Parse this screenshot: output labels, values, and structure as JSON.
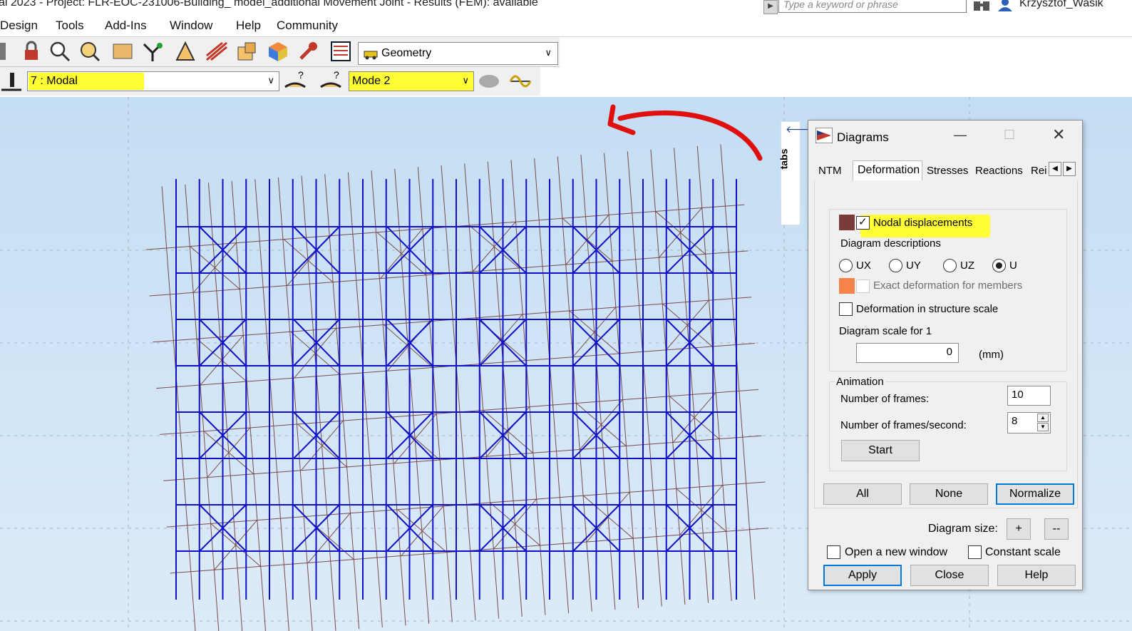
{
  "window": {
    "title": "al 2023 - Project: FLR-EOC-231006-Building_ model_additional Movement Joint - Results (FEM): available",
    "search_placeholder": "Type a keyword or phrase",
    "user": "Krzysztof_Wasik"
  },
  "menu": [
    "Design",
    "Tools",
    "Add-Ins",
    "Window",
    "Help",
    "Community"
  ],
  "toolbar": {
    "view_select": "Geometry",
    "load_case_select": "7 : Modal",
    "mode_select": "Mode  2"
  },
  "tabs_strip": {
    "label": "tabs"
  },
  "dialog": {
    "title": "Diagrams",
    "tabs": [
      "NTM",
      "Deformation",
      "Stresses",
      "Reactions",
      "Rei"
    ],
    "active_tab": "Deformation",
    "nodal_displacements": {
      "label": "Nodal displacements",
      "checked": true,
      "color": "#7a3b3b"
    },
    "diagram_descriptions_label": "Diagram descriptions",
    "radios": [
      {
        "label": "UX",
        "selected": false
      },
      {
        "label": "UY",
        "selected": false
      },
      {
        "label": "UZ",
        "selected": false
      },
      {
        "label": "U",
        "selected": true
      }
    ],
    "exact_deformation": {
      "label": "Exact deformation for members",
      "checked": false,
      "color": "#f5834a"
    },
    "structure_scale": {
      "label": "Deformation in structure scale",
      "checked": false
    },
    "diagram_scale": {
      "label": "Diagram scale for 1",
      "value": "0",
      "unit": "(mm)"
    },
    "animation": {
      "title": "Animation",
      "frames_label": "Number of frames:",
      "frames_value": "10",
      "fps_label": "Number of frames/second:",
      "fps_value": "8",
      "start_label": "Start"
    },
    "buttons_row": [
      "All",
      "None",
      "Normalize"
    ],
    "diagram_size_label": "Diagram size:",
    "size_plus": "+",
    "size_minus": "--",
    "open_new_window": {
      "label": "Open a new window",
      "checked": false
    },
    "constant_scale": {
      "label": "Constant scale",
      "checked": false
    },
    "footer_buttons": [
      "Apply",
      "Close",
      "Help"
    ]
  },
  "colors": {
    "highlight": "#ffff33",
    "structure_blue": "#1010c8",
    "deformed_brown": "#7a4a4a",
    "annotation_arrow": "#e01010"
  }
}
